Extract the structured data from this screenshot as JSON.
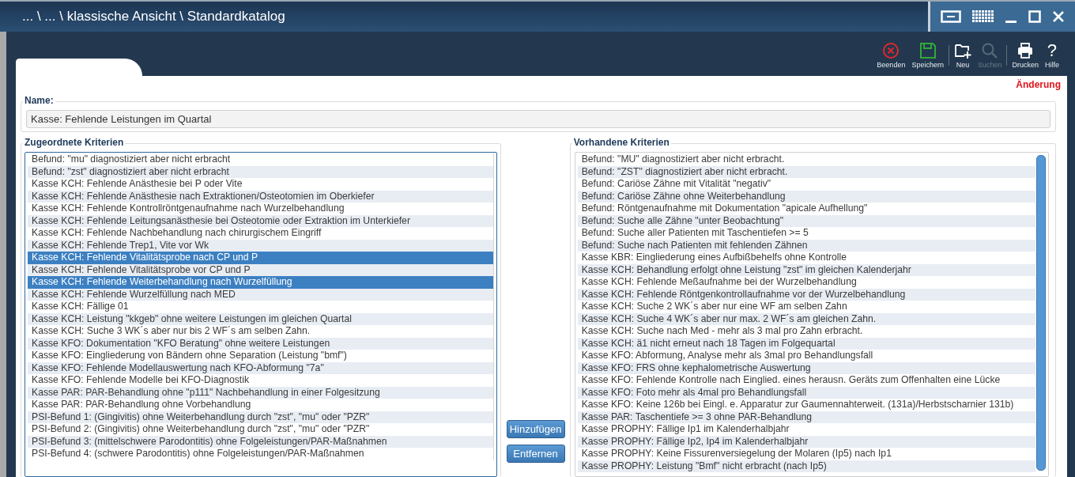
{
  "window": {
    "title": "... \\ ... \\ klassische Ansicht \\ Standardkatalog"
  },
  "toolbar": [
    {
      "kind": "close",
      "label": "Beenden",
      "disabled": false
    },
    {
      "kind": "save",
      "label": "Speichern",
      "disabled": false
    },
    {
      "kind": "new",
      "label": "Neu",
      "disabled": false
    },
    {
      "kind": "search",
      "label": "Suchen",
      "disabled": true
    },
    {
      "kind": "print",
      "label": "Drucken",
      "disabled": false
    },
    {
      "kind": "help",
      "label": "Hilfe",
      "icon": "?",
      "disabled": false
    }
  ],
  "status": "Änderung",
  "name": {
    "label": "Name:",
    "value": "Kasse: Fehlende Leistungen im Quartal"
  },
  "assigned": {
    "title": "Zugeordnete Kriterien",
    "items": [
      {
        "text": "Befund: \"mu\" diagnostiziert aber nicht erbracht",
        "selected": false
      },
      {
        "text": "Befund: \"zst\" diagnostiziert aber nicht erbracht",
        "selected": false
      },
      {
        "text": "Kasse KCH: Fehlende Anästhesie bei P oder Vite",
        "selected": false
      },
      {
        "text": "Kasse KCH: Fehlende Anästhesie nach Extraktionen/Osteotomien im Oberkiefer",
        "selected": false
      },
      {
        "text": "Kasse KCH: Fehlende Kontrollröntgenaufnahme nach Wurzelbehandlung",
        "selected": false
      },
      {
        "text": "Kasse KCH: Fehlende Leitungsanästhesie bei Osteotomie oder Extraktion im Unterkiefer",
        "selected": false
      },
      {
        "text": "Kasse KCH: Fehlende Nachbehandlung nach chirurgischem Eingriff",
        "selected": false
      },
      {
        "text": "Kasse KCH: Fehlende Trep1, Vite vor Wk",
        "selected": false
      },
      {
        "text": "Kasse KCH: Fehlende Vitalitätsprobe nach CP und P",
        "selected": true
      },
      {
        "text": "Kasse KCH: Fehlende Vitalitätsprobe vor CP und P",
        "selected": false
      },
      {
        "text": "Kasse KCH: Fehlende Weiterbehandlung nach Wurzelfüllung",
        "selected": true
      },
      {
        "text": "Kasse KCH: Fehlende Wurzelfüllung nach MED",
        "selected": false
      },
      {
        "text": "Kasse KCH: Fällige 01",
        "selected": false
      },
      {
        "text": "Kasse KCH: Leistung \"kkgeb\" ohne weitere Leistungen im gleichen Quartal",
        "selected": false
      },
      {
        "text": "Kasse KCH: Suche 3 WK´s aber nur bis 2 WF´s am selben Zahn.",
        "selected": false
      },
      {
        "text": "Kasse KFO: Dokumentation \"KFO Beratung\" ohne weitere Leistungen",
        "selected": false
      },
      {
        "text": "Kasse KFO: Eingliederung von Bändern ohne Separation (Leistung \"bmf\")",
        "selected": false
      },
      {
        "text": "Kasse KFO: Fehlende Modellauswertung nach KFO-Abformung \"7a\"",
        "selected": false
      },
      {
        "text": "Kasse KFO: Fehlende Modelle bei KFO-Diagnostik",
        "selected": false
      },
      {
        "text": "Kasse PAR: PAR-Behandlung ohne \"p111\" Nachbehandlung in einer Folgesitzung",
        "selected": false
      },
      {
        "text": "Kasse PAR: PAR-Behandlung ohne Vorbehandlung",
        "selected": false
      },
      {
        "text": "PSI-Befund 1: (Gingivitis) ohne Weiterbehandlung durch \"zst\", \"mu\" oder \"PZR\"",
        "selected": false
      },
      {
        "text": "PSI-Befund 2: (Gingivitis) ohne Weiterbehandlung durch \"zst\", \"mu\" oder \"PZR\"",
        "selected": false
      },
      {
        "text": "PSI-Befund 3: (mittelschwere Parodontitis) ohne Folgeleistungen/PAR-Maßnahmen",
        "selected": false
      },
      {
        "text": "PSI-Befund 4: (schwere Parodontitis) ohne Folgeleistungen/PAR-Maßnahmen",
        "selected": false
      }
    ]
  },
  "buttons": [
    "Hinzufügen",
    "Entfernen"
  ],
  "available": {
    "title": "Vorhandene Kriterien",
    "items": [
      {
        "text": "Befund: \"MU\" diagnostiziert aber nicht erbracht.",
        "selected": false
      },
      {
        "text": "Befund: \"ZST\" diagnostiziert aber nicht erbracht.",
        "selected": false
      },
      {
        "text": "Befund: Cariöse Zähne mit Vitalität \"negativ\"",
        "selected": false
      },
      {
        "text": "Befund: Cariöse Zähne ohne Weiterbehandlung",
        "selected": false
      },
      {
        "text": "Befund: Röntgenaufnahme mit Dokumentation \"apicale Aufhellung\"",
        "selected": false
      },
      {
        "text": "Befund: Suche alle Zähne \"unter Beobachtung\"",
        "selected": false
      },
      {
        "text": "Befund: Suche aller Patienten mit Taschentiefen >= 5",
        "selected": false
      },
      {
        "text": "Befund: Suche nach Patienten mit fehlenden Zähnen",
        "selected": false
      },
      {
        "text": "Kasse KBR: Eingliederung eines Aufbißbehelfs ohne Kontrolle",
        "selected": false
      },
      {
        "text": "Kasse KCH: Behandlung erfolgt ohne Leistung \"zst\" im gleichen Kalenderjahr",
        "selected": false
      },
      {
        "text": "Kasse KCH: Fehlende Meßaufnahme bei der Wurzelbehandlung",
        "selected": false
      },
      {
        "text": "Kasse KCH: Fehlende Röntgenkontrollaufnahme vor der Wurzelbehandlung",
        "selected": false
      },
      {
        "text": "Kasse KCH: Suche 2 WK´s aber nur eine WF am selben Zahn",
        "selected": false
      },
      {
        "text": "Kasse KCH: Suche 4 WK´s aber nur max. 2 WF´s am gleichen Zahn.",
        "selected": false
      },
      {
        "text": "Kasse KCH: Suche nach Med - mehr als 3 mal pro Zahn erbracht.",
        "selected": false
      },
      {
        "text": "Kasse KCH: ä1 nicht erneut nach 18 Tagen im Folgequartal",
        "selected": false
      },
      {
        "text": "Kasse KFO: Abformung, Analyse mehr als 3mal pro Behandlungsfall",
        "selected": false
      },
      {
        "text": "Kasse KFO: FRS ohne kephalometrische Auswertung",
        "selected": false
      },
      {
        "text": "Kasse KFO: Fehlende Kontrolle nach Einglied. eines herausn. Geräts zum Offenhalten eine Lücke",
        "selected": false
      },
      {
        "text": "Kasse KFO: Foto mehr als 4mal pro Behandlungsfall",
        "selected": false
      },
      {
        "text": "Kasse KFO: Keine 126b bei Eingl. e. Apparatur zur Gaumennahterweit. (131a)/Herbstscharnier 131b)",
        "selected": false
      },
      {
        "text": "Kasse PAR: Taschentiefe >= 3 ohne PAR-Behandlung",
        "selected": false
      },
      {
        "text": "Kasse PROPHY: Fällige Ip1 im Kalenderhalbjahr",
        "selected": false
      },
      {
        "text": "Kasse PROPHY: Fällige Ip2, Ip4 im Kalenderhalbjahr",
        "selected": false
      },
      {
        "text": "Kasse PROPHY: Keine Fissurenversiegelung der Molaren (Ip5) nach Ip1",
        "selected": false
      },
      {
        "text": "Kasse PROPHY: Leistung \"Bmf\" nicht erbracht (nach Ip5)",
        "selected": false
      }
    ]
  }
}
